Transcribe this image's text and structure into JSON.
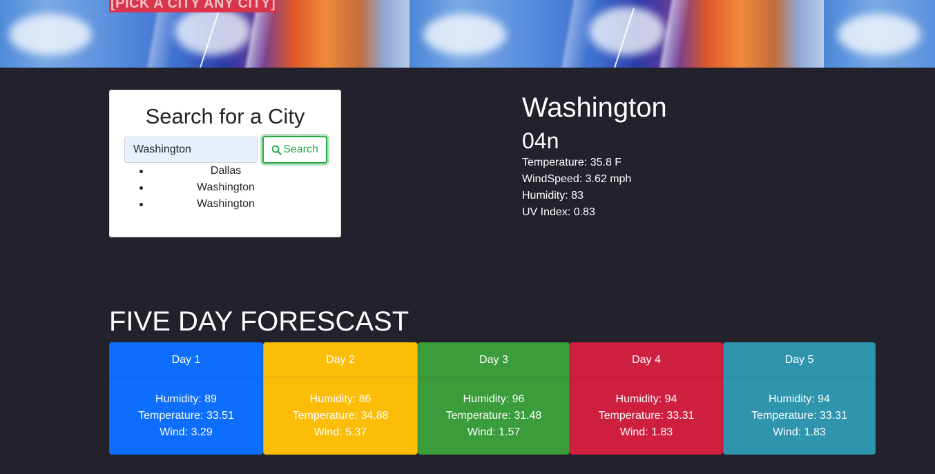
{
  "banner": {
    "title": "[PICK A CITY ANY CITY]"
  },
  "search": {
    "title": "Search for a City",
    "input_value": "Washington",
    "button_label": "Search",
    "history": [
      "Dallas",
      "Washington",
      "Washington"
    ]
  },
  "current": {
    "city": "Washington",
    "icon": "04n",
    "temperature": "Temperature: 35.8 F",
    "wind": "WindSpeed: 3.62 mph",
    "humidity": "Humidity: 83",
    "uv": "UV Index: 0.83"
  },
  "forecast": {
    "title": "FIVE DAY FORESCAST",
    "days": [
      {
        "label": "Day 1",
        "humidity": "Humidity: 89",
        "temperature": "Temperature: 33.51",
        "wind": "Wind: 3.29",
        "color": "#0d6efd",
        "text_color": "#ffffff"
      },
      {
        "label": "Day 2",
        "humidity": "Humidity: 86",
        "temperature": "Temperature: 34.88",
        "wind": "Wind: 5.37",
        "color": "#fbbd08",
        "text_color": "#ffffff"
      },
      {
        "label": "Day 3",
        "humidity": "Humidity: 96",
        "temperature": "Temperature: 31.48",
        "wind": "Wind: 1.57",
        "color": "#3a9c3a",
        "text_color": "#ffffff"
      },
      {
        "label": "Day 4",
        "humidity": "Humidity: 94",
        "temperature": "Temperature: 33.31",
        "wind": "Wind: 1.83",
        "color": "#cf1f3f",
        "text_color": "#ffffff"
      },
      {
        "label": "Day 5",
        "humidity": "Humidity: 94",
        "temperature": "Temperature: 33.31",
        "wind": "Wind: 1.83",
        "color": "#2e95ad",
        "text_color": "#ffffff"
      }
    ]
  },
  "colors": {
    "page_background": "#22212c",
    "search_button": "#28a745",
    "banner_title_bg": "#d8344a"
  },
  "icons": {
    "search_button_icon": "search-icon"
  }
}
